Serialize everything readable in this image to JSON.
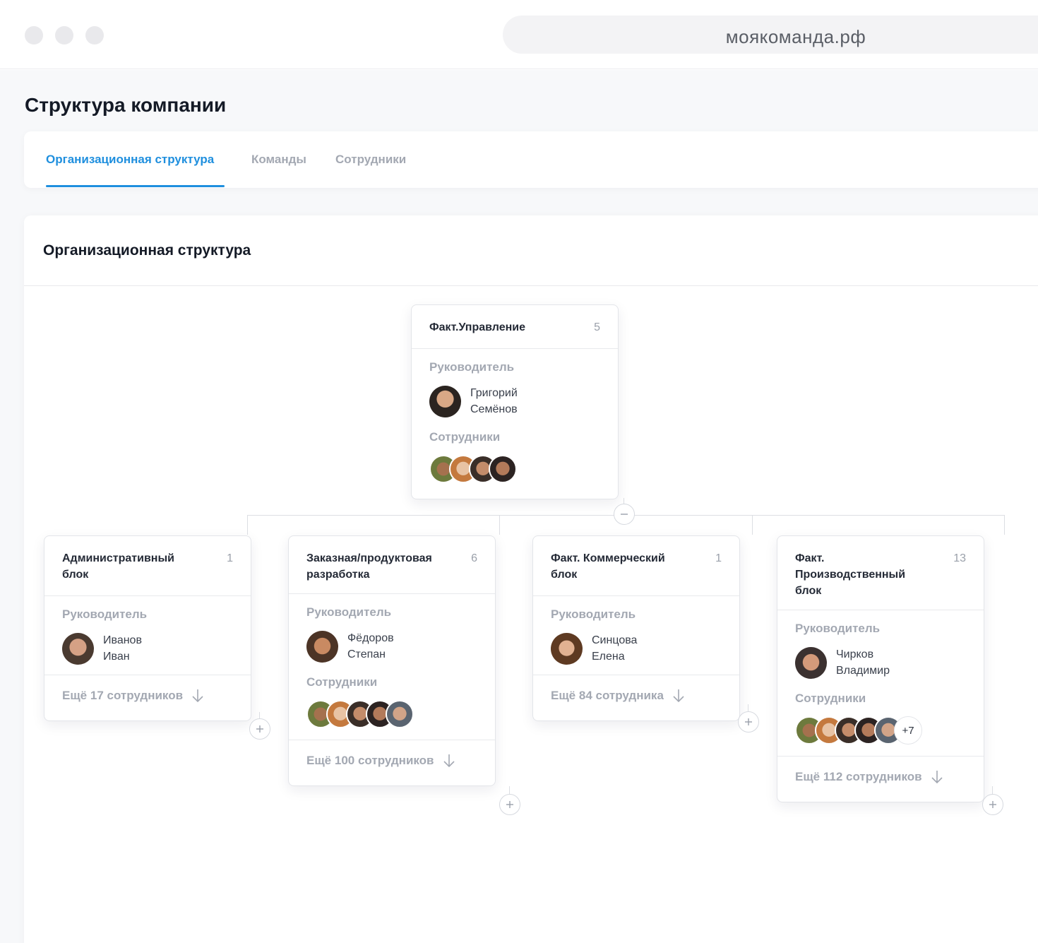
{
  "browser": {
    "url": "моякоманда.рф"
  },
  "page": {
    "title": "Структура компании"
  },
  "tabs": [
    {
      "label": "Организационная структура",
      "active": true
    },
    {
      "label": "Команды",
      "active": false
    },
    {
      "label": "Сотрудники",
      "active": false
    }
  ],
  "section": {
    "title": "Организационная структура"
  },
  "labels": {
    "manager": "Руководитель",
    "employees": "Сотрудники"
  },
  "root": {
    "name": "Факт.Управление",
    "count": "5",
    "manager_first": "Григорий",
    "manager_last": "Семёнов"
  },
  "nodes": [
    {
      "name": "Административный блок",
      "count": "1",
      "manager_first": "Иванов",
      "manager_last": "Иван",
      "more": "Ещё 17 сотрудников"
    },
    {
      "name": "Заказная/продуктовая разработка",
      "count": "6",
      "manager_first": "Фёдоров",
      "manager_last": "Степан",
      "more": "Ещё 100 сотрудников"
    },
    {
      "name": "Факт. Коммерческий блок",
      "count": "1",
      "manager_first": "Синцова",
      "manager_last": "Елена",
      "more": "Ещё 84 сотрудника"
    },
    {
      "name": "Факт. Производственный блок",
      "count": "13",
      "manager_first": "Чирков",
      "manager_last": "Владимир",
      "extra_employees": "+7",
      "more": "Ещё 112 сотрудников"
    }
  ],
  "colors": {
    "accent": "#1f8fde",
    "muted": "#a3a8b2",
    "line": "#dcdee3"
  }
}
